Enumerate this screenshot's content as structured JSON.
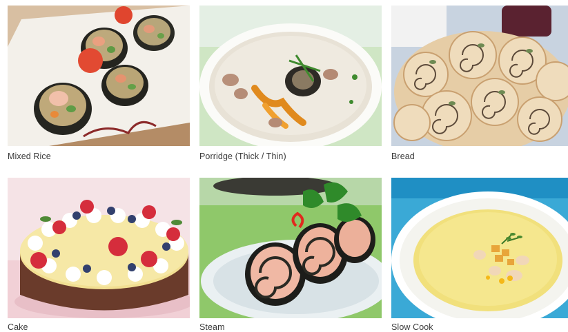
{
  "tiles": [
    {
      "id": "mixed-rice",
      "label": "Mixed Rice"
    },
    {
      "id": "porridge",
      "label": "Porridge (Thick / Thin)"
    },
    {
      "id": "bread",
      "label": "Bread"
    },
    {
      "id": "cake",
      "label": "Cake"
    },
    {
      "id": "steam",
      "label": "Steam"
    },
    {
      "id": "slow-cook",
      "label": "Slow Cook"
    }
  ]
}
